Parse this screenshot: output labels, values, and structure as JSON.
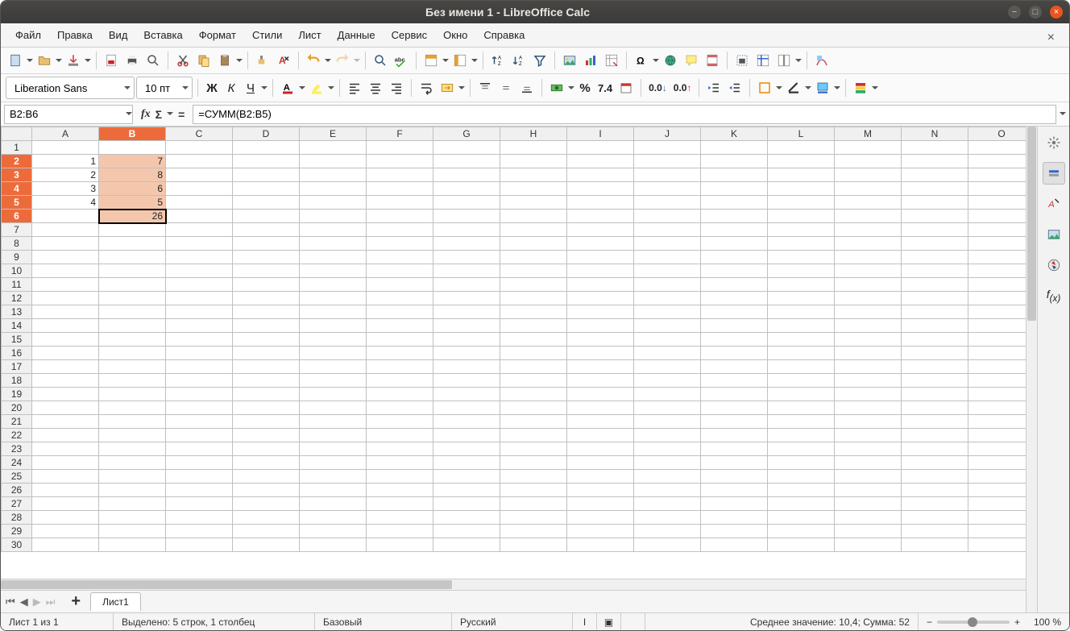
{
  "window": {
    "title": "Без имени 1 - LibreOffice Calc"
  },
  "menu": {
    "items": [
      "Файл",
      "Правка",
      "Вид",
      "Вставка",
      "Формат",
      "Стили",
      "Лист",
      "Данные",
      "Сервис",
      "Окно",
      "Справка"
    ]
  },
  "format_bar": {
    "font_name": "Liberation Sans",
    "font_size": "10 пт",
    "bold": "Ж",
    "italic": "К",
    "underline": "Ч",
    "percent": "%",
    "number_fmt": "7.4"
  },
  "formula_bar": {
    "name_box": "B2:B6",
    "fx": "fx",
    "sigma": "Σ",
    "eq": "=",
    "formula": "=СУММ(B2:B5)"
  },
  "sheet": {
    "columns": [
      "A",
      "B",
      "C",
      "D",
      "E",
      "F",
      "G",
      "H",
      "I",
      "J",
      "K",
      "L",
      "M",
      "N",
      "O"
    ],
    "row_count": 30,
    "selected_col_index": 1,
    "selected_rows": [
      2,
      3,
      4,
      5,
      6
    ],
    "cursor": {
      "row": 6,
      "col": 1
    },
    "cells": {
      "2": {
        "0": "1",
        "1": "7"
      },
      "3": {
        "0": "2",
        "1": "8"
      },
      "4": {
        "0": "3",
        "1": "6"
      },
      "5": {
        "0": "4",
        "1": "5"
      },
      "6": {
        "1": "26"
      }
    }
  },
  "tabs": {
    "sheet1": "Лист1"
  },
  "status": {
    "sheet_info": "Лист 1 из 1",
    "selection": "Выделено: 5 строк, 1 столбец",
    "style": "Базовый",
    "lang": "Русский",
    "aggregate": "Среднее значение: 10,4; Сумма: 52",
    "zoom": "100 %",
    "minus": "−",
    "plus": "+"
  },
  "sidebar": {
    "fx": "f",
    "fx_sub": "(x)"
  }
}
